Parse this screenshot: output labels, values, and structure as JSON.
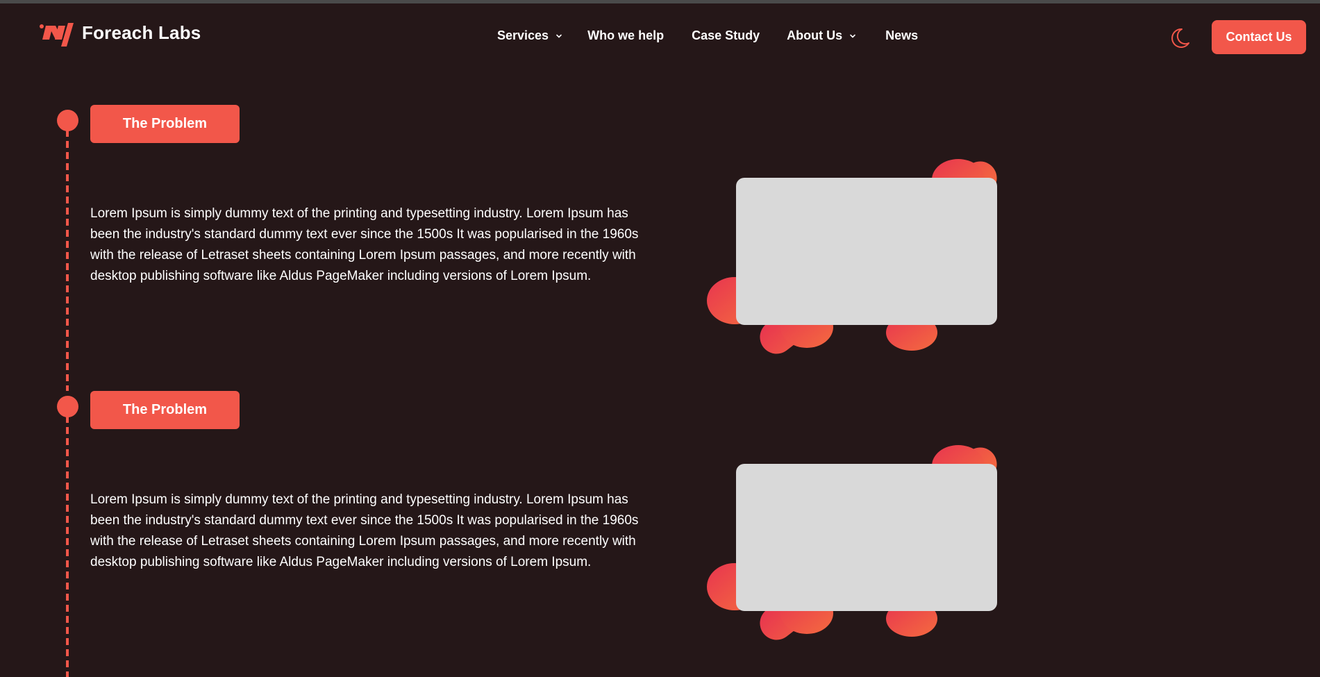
{
  "brand": {
    "name": "Foreach Labs",
    "accent": "#f2574a",
    "background": "#251718"
  },
  "nav": {
    "items": [
      {
        "label": "Services",
        "has_dropdown": true
      },
      {
        "label": "Who we help",
        "has_dropdown": false
      },
      {
        "label": "Case Study",
        "has_dropdown": false
      },
      {
        "label": "About Us",
        "has_dropdown": true
      },
      {
        "label": "News",
        "has_dropdown": false
      }
    ],
    "theme_toggle_icon": "moon-icon",
    "contact_label": "Contact Us"
  },
  "timeline": [
    {
      "tag": "The Problem",
      "text": "Lorem Ipsum is simply dummy text of the printing and typesetting industry. Lorem Ipsum has been the industry's standard dummy text ever since the 1500s It was popularised in the 1960s with the release of Letraset sheets containing Lorem Ipsum passages, and more recently with desktop publishing software like Aldus PageMaker including versions of Lorem Ipsum."
    },
    {
      "tag": "The Problem",
      "text": "Lorem Ipsum is simply dummy text of the printing and typesetting industry. Lorem Ipsum has been the industry's standard dummy text ever since the 1500s It was popularised in the 1960s with the release of Letraset sheets containing Lorem Ipsum passages, and more recently with desktop publishing software like Aldus PageMaker including versions of Lorem Ipsum."
    }
  ]
}
